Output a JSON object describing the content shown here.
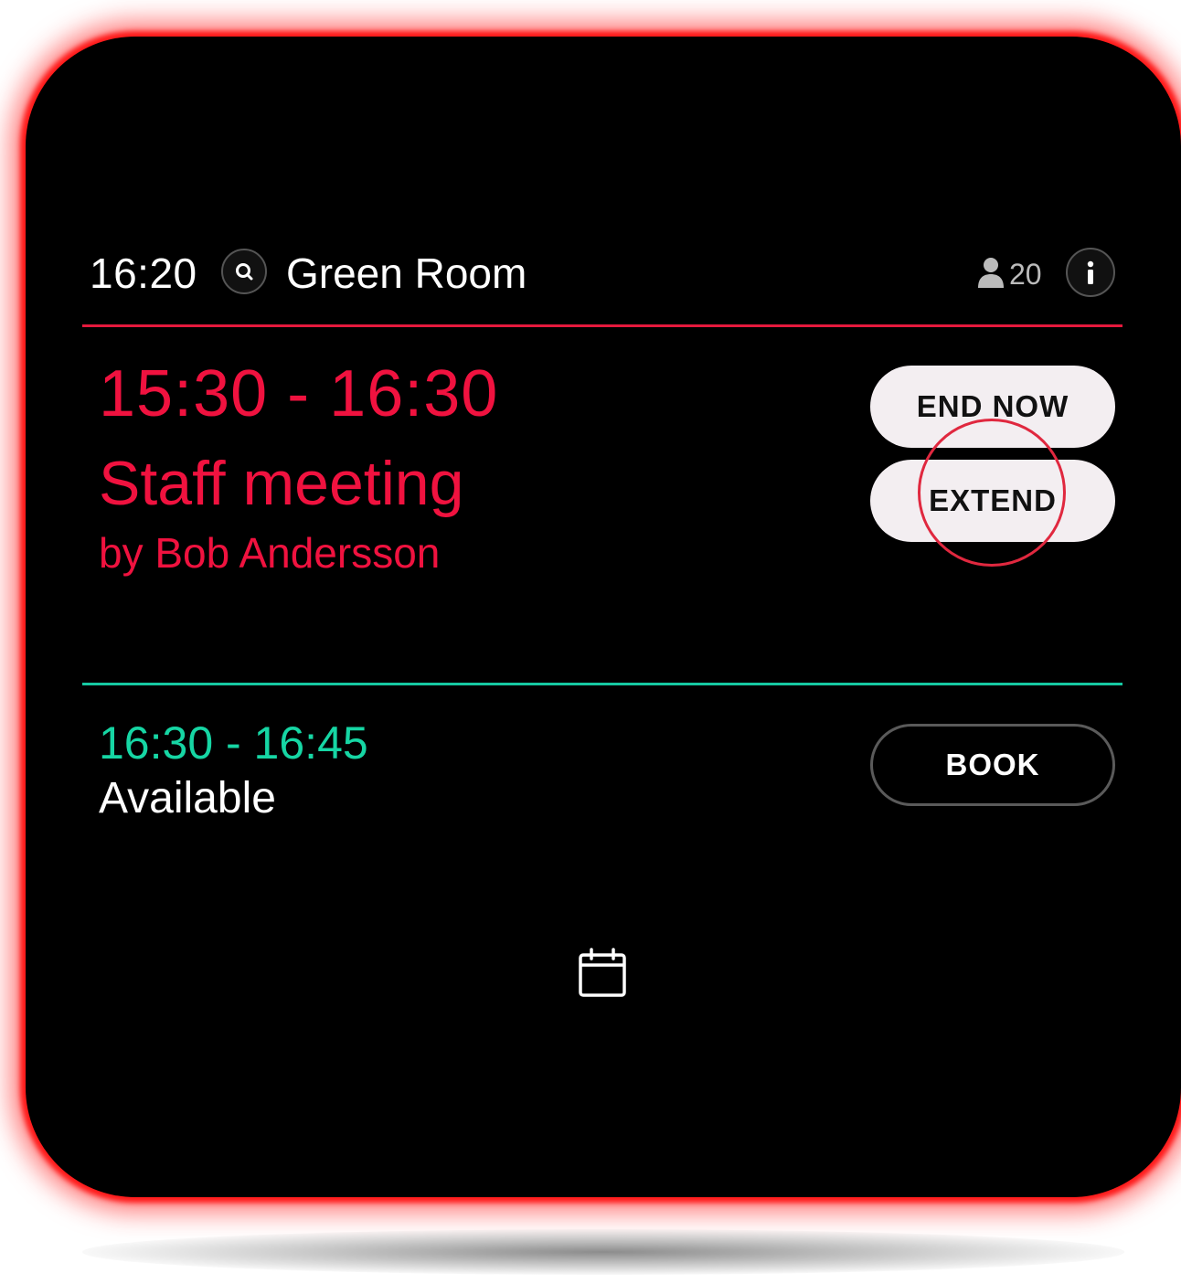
{
  "header": {
    "clock": "16:20",
    "room_name": "Green Room",
    "capacity": "20",
    "search_icon": "search-icon",
    "info_icon": "info-icon"
  },
  "current_meeting": {
    "time_range": "15:30 - 16:30",
    "title": "Staff meeting",
    "organizer": "by Bob Andersson",
    "end_now_label": "END NOW",
    "extend_label": "EXTEND"
  },
  "next_slot": {
    "time_range": "16:30 - 16:45",
    "status": "Available",
    "book_label": "BOOK"
  },
  "footer": {
    "calendar_icon": "calendar-icon"
  },
  "colors": {
    "busy": "#f0123f",
    "available": "#16d6a4",
    "background": "#000000",
    "glow": "#ff1e1e"
  }
}
